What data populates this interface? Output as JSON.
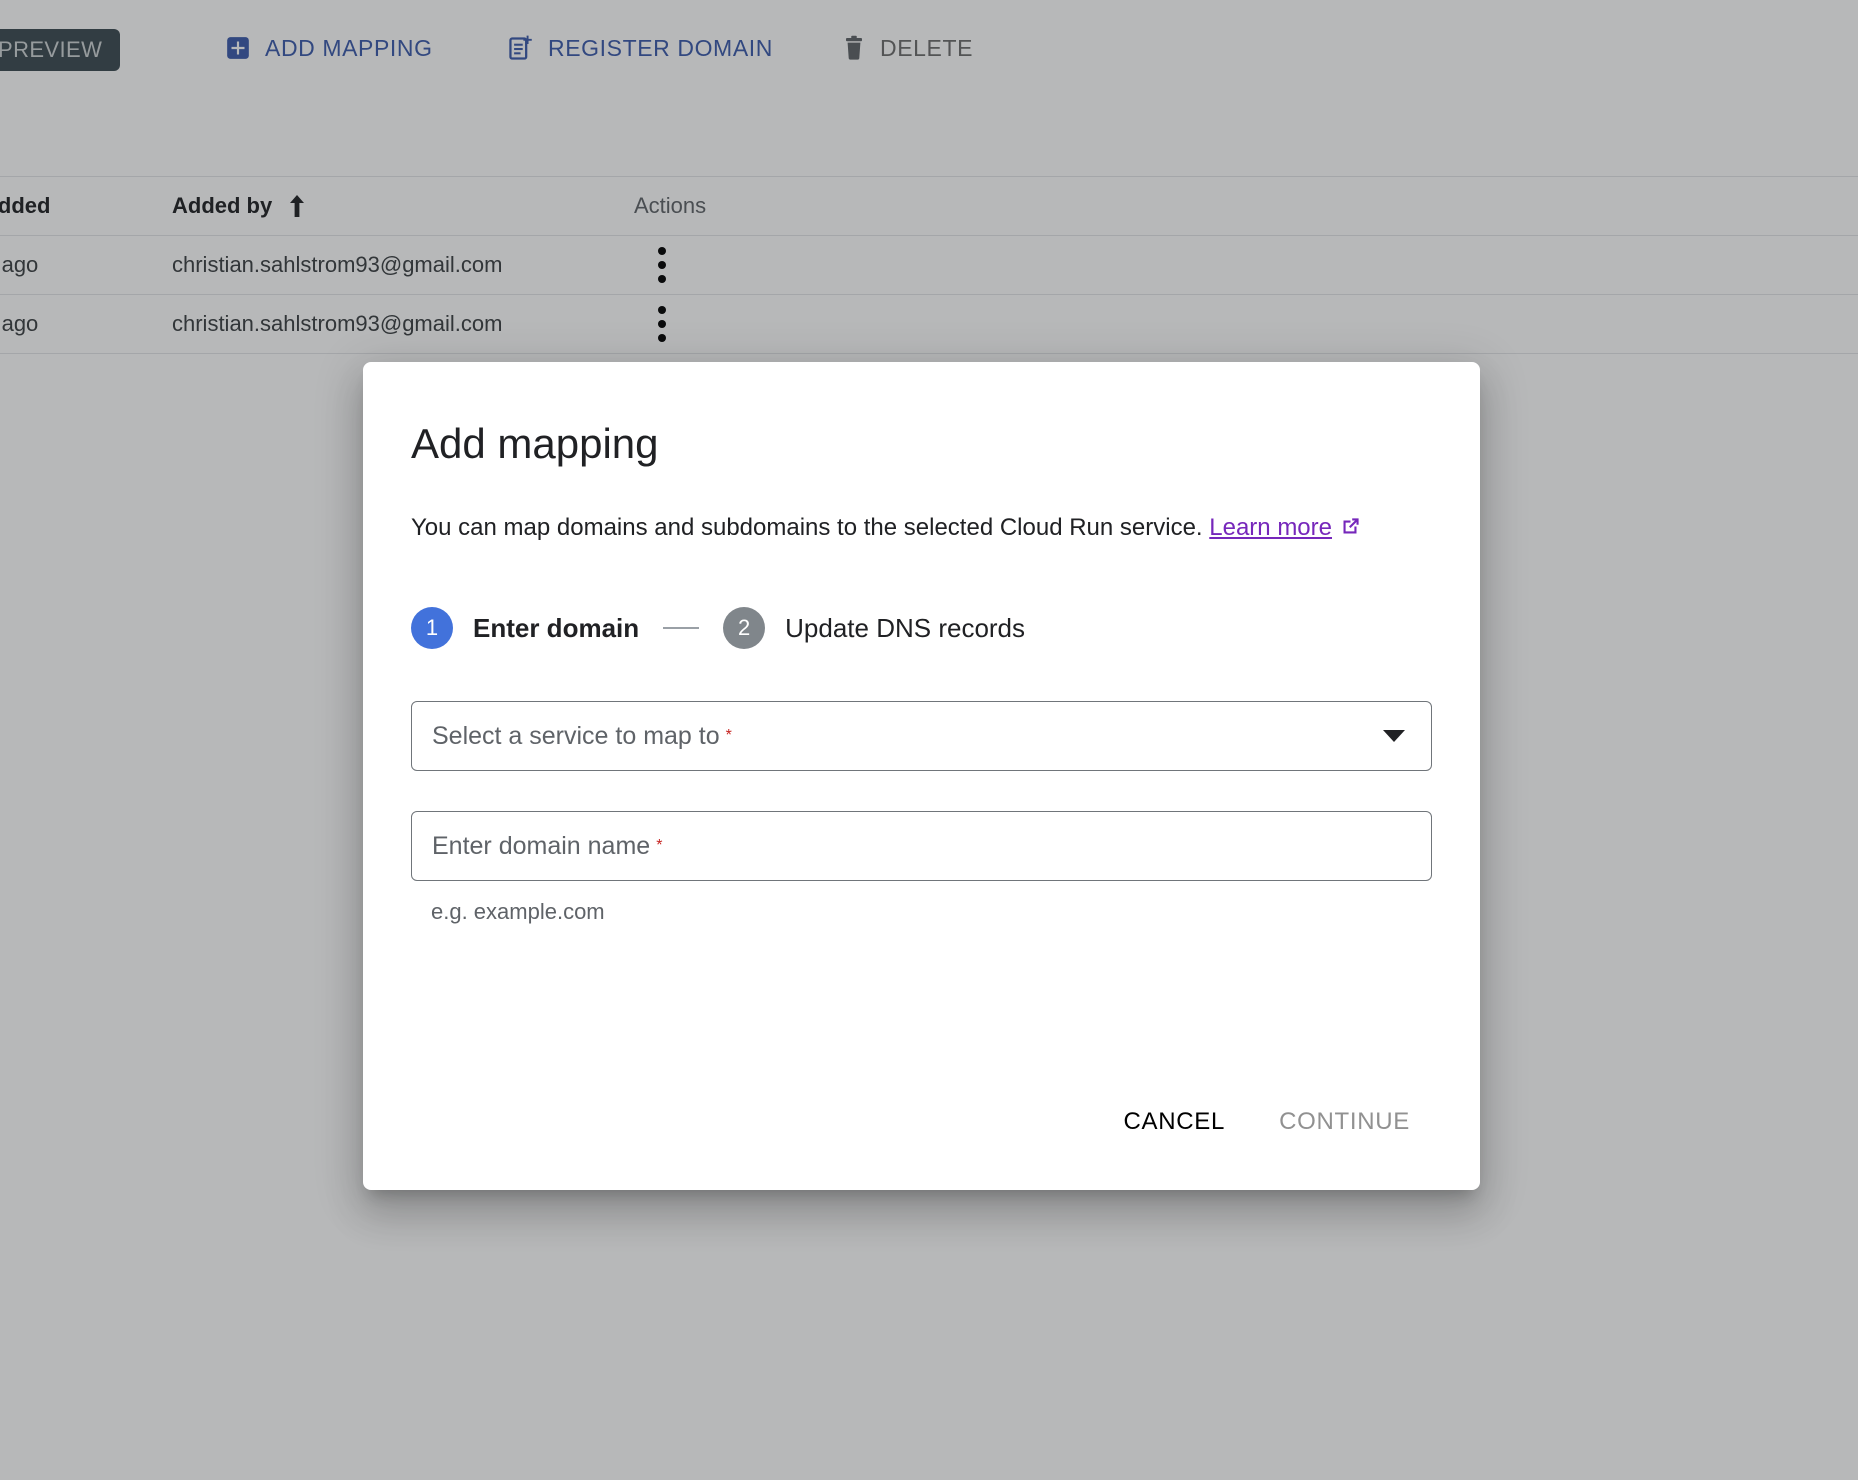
{
  "toolbar": {
    "preview_chip": "PREVIEW",
    "buttons": [
      {
        "label": "ADD MAPPING",
        "icon": "add-box-icon",
        "state": "enabled"
      },
      {
        "label": "REGISTER DOMAIN",
        "icon": "document-add-icon",
        "state": "enabled"
      },
      {
        "label": "DELETE",
        "icon": "trash-icon",
        "state": "disabled"
      }
    ]
  },
  "table": {
    "columns": [
      {
        "label": "te added",
        "sorted": false
      },
      {
        "label": "Added by",
        "sorted": true,
        "sort_direction": "ascending",
        "sort_icon": "arrow-up-icon"
      },
      {
        "label": "Actions",
        "sorted": false
      }
    ],
    "rows": [
      {
        "date_added": "day ago",
        "added_by": "christian.sahlstrom93@gmail.com",
        "actions_icon": "kebab-menu-icon"
      },
      {
        "date_added": "day ago",
        "added_by": "christian.sahlstrom93@gmail.com",
        "actions_icon": "kebab-menu-icon"
      }
    ]
  },
  "dialog": {
    "title": "Add mapping",
    "description_text": "You can map domains and subdomains to the selected Cloud Run service.",
    "learn_more_label": "Learn more",
    "learn_more_icon": "open-in-new-icon",
    "steps": [
      {
        "number": "1",
        "label": "Enter domain",
        "state": "active"
      },
      {
        "number": "2",
        "label": "Update DNS records",
        "state": "inactive"
      }
    ],
    "service_select": {
      "label": "Select a service to map to",
      "required_marker": "*",
      "value": "",
      "icon": "chevron-down-icon"
    },
    "domain_input": {
      "label": "Enter domain name",
      "required_marker": "*",
      "value": "",
      "placeholder": "",
      "hint": "e.g. example.com"
    },
    "actions": [
      {
        "label": "CANCEL",
        "state": "enabled"
      },
      {
        "label": "CONTINUE",
        "state": "disabled"
      }
    ]
  },
  "colors": {
    "accent_blue": "#3b5bab",
    "step_active": "#4272db",
    "step_inactive": "#80868b",
    "link_purple": "#7627bb",
    "required_red": "#c5221f",
    "preview_chip_bg": "#3c4a51",
    "disabled_gray": "#919191"
  }
}
